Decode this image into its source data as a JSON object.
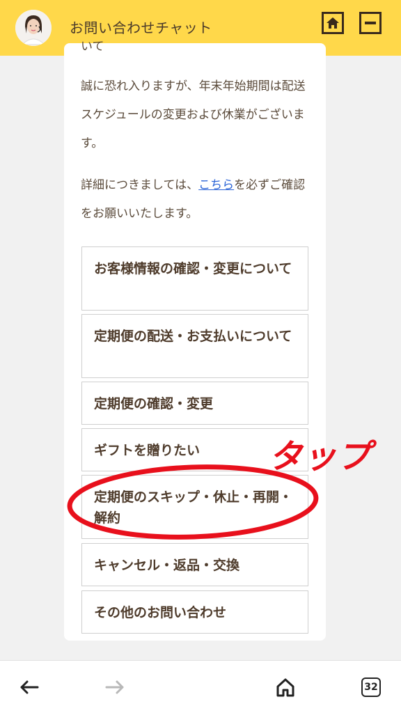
{
  "header": {
    "title": "お問い合わせチャット",
    "avatar_icon": "operator-avatar-icon",
    "home_icon": "home-icon",
    "minimize_icon": "minimize-icon"
  },
  "message": {
    "partial_top": "いて",
    "para1": "誠に恐れ入りますが、年末年始期間は配送スケジュールの変更および休業がございます。",
    "para2_before": "詳細につきましては、",
    "para2_link": "こちら",
    "para2_after": "を必ずご確認をお願いいたします。"
  },
  "options": [
    {
      "label": "お客様情報の確認・変更について"
    },
    {
      "label": "定期便の配送・お支払いについて"
    },
    {
      "label": "定期便の確認・変更"
    },
    {
      "label": "ギフトを贈りたい"
    },
    {
      "label": "定期便のスキップ・休止・再開・解約"
    },
    {
      "label": "キャンセル・返品・交換"
    },
    {
      "label": "その他のお問い合わせ"
    }
  ],
  "annotation": {
    "tap_label": "タップ",
    "color": "#e8101c"
  },
  "browser_bar": {
    "back_icon": "back-arrow-icon",
    "forward_icon": "forward-arrow-icon",
    "home_icon": "home-outline-icon",
    "tab_count": "32"
  },
  "colors": {
    "header_bg": "#ffd84a",
    "text_brown": "#4e3b2b",
    "link": "#2a63d6"
  }
}
